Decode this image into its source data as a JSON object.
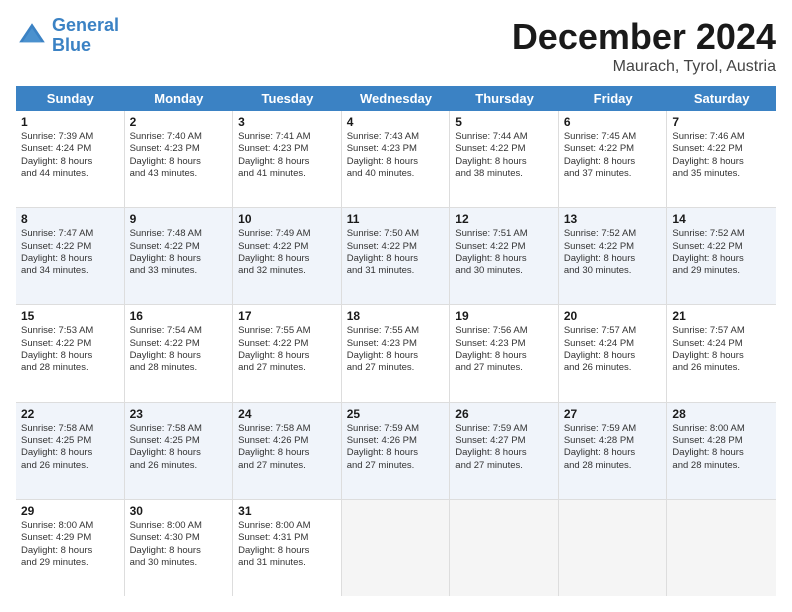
{
  "logo": {
    "line1": "General",
    "line2": "Blue"
  },
  "header": {
    "title": "December 2024",
    "subtitle": "Maurach, Tyrol, Austria"
  },
  "days": [
    "Sunday",
    "Monday",
    "Tuesday",
    "Wednesday",
    "Thursday",
    "Friday",
    "Saturday"
  ],
  "weeks": [
    [
      {
        "day": "1",
        "sunrise": "Sunrise: 7:39 AM",
        "sunset": "Sunset: 4:24 PM",
        "daylight": "Daylight: 8 hours",
        "minutes": "and 44 minutes.",
        "shaded": false
      },
      {
        "day": "2",
        "sunrise": "Sunrise: 7:40 AM",
        "sunset": "Sunset: 4:23 PM",
        "daylight": "Daylight: 8 hours",
        "minutes": "and 43 minutes.",
        "shaded": false
      },
      {
        "day": "3",
        "sunrise": "Sunrise: 7:41 AM",
        "sunset": "Sunset: 4:23 PM",
        "daylight": "Daylight: 8 hours",
        "minutes": "and 41 minutes.",
        "shaded": false
      },
      {
        "day": "4",
        "sunrise": "Sunrise: 7:43 AM",
        "sunset": "Sunset: 4:23 PM",
        "daylight": "Daylight: 8 hours",
        "minutes": "and 40 minutes.",
        "shaded": false
      },
      {
        "day": "5",
        "sunrise": "Sunrise: 7:44 AM",
        "sunset": "Sunset: 4:22 PM",
        "daylight": "Daylight: 8 hours",
        "minutes": "and 38 minutes.",
        "shaded": false
      },
      {
        "day": "6",
        "sunrise": "Sunrise: 7:45 AM",
        "sunset": "Sunset: 4:22 PM",
        "daylight": "Daylight: 8 hours",
        "minutes": "and 37 minutes.",
        "shaded": false
      },
      {
        "day": "7",
        "sunrise": "Sunrise: 7:46 AM",
        "sunset": "Sunset: 4:22 PM",
        "daylight": "Daylight: 8 hours",
        "minutes": "and 35 minutes.",
        "shaded": false
      }
    ],
    [
      {
        "day": "8",
        "sunrise": "Sunrise: 7:47 AM",
        "sunset": "Sunset: 4:22 PM",
        "daylight": "Daylight: 8 hours",
        "minutes": "and 34 minutes.",
        "shaded": true
      },
      {
        "day": "9",
        "sunrise": "Sunrise: 7:48 AM",
        "sunset": "Sunset: 4:22 PM",
        "daylight": "Daylight: 8 hours",
        "minutes": "and 33 minutes.",
        "shaded": true
      },
      {
        "day": "10",
        "sunrise": "Sunrise: 7:49 AM",
        "sunset": "Sunset: 4:22 PM",
        "daylight": "Daylight: 8 hours",
        "minutes": "and 32 minutes.",
        "shaded": true
      },
      {
        "day": "11",
        "sunrise": "Sunrise: 7:50 AM",
        "sunset": "Sunset: 4:22 PM",
        "daylight": "Daylight: 8 hours",
        "minutes": "and 31 minutes.",
        "shaded": true
      },
      {
        "day": "12",
        "sunrise": "Sunrise: 7:51 AM",
        "sunset": "Sunset: 4:22 PM",
        "daylight": "Daylight: 8 hours",
        "minutes": "and 30 minutes.",
        "shaded": true
      },
      {
        "day": "13",
        "sunrise": "Sunrise: 7:52 AM",
        "sunset": "Sunset: 4:22 PM",
        "daylight": "Daylight: 8 hours",
        "minutes": "and 30 minutes.",
        "shaded": true
      },
      {
        "day": "14",
        "sunrise": "Sunrise: 7:52 AM",
        "sunset": "Sunset: 4:22 PM",
        "daylight": "Daylight: 8 hours",
        "minutes": "and 29 minutes.",
        "shaded": true
      }
    ],
    [
      {
        "day": "15",
        "sunrise": "Sunrise: 7:53 AM",
        "sunset": "Sunset: 4:22 PM",
        "daylight": "Daylight: 8 hours",
        "minutes": "and 28 minutes.",
        "shaded": false
      },
      {
        "day": "16",
        "sunrise": "Sunrise: 7:54 AM",
        "sunset": "Sunset: 4:22 PM",
        "daylight": "Daylight: 8 hours",
        "minutes": "and 28 minutes.",
        "shaded": false
      },
      {
        "day": "17",
        "sunrise": "Sunrise: 7:55 AM",
        "sunset": "Sunset: 4:22 PM",
        "daylight": "Daylight: 8 hours",
        "minutes": "and 27 minutes.",
        "shaded": false
      },
      {
        "day": "18",
        "sunrise": "Sunrise: 7:55 AM",
        "sunset": "Sunset: 4:23 PM",
        "daylight": "Daylight: 8 hours",
        "minutes": "and 27 minutes.",
        "shaded": false
      },
      {
        "day": "19",
        "sunrise": "Sunrise: 7:56 AM",
        "sunset": "Sunset: 4:23 PM",
        "daylight": "Daylight: 8 hours",
        "minutes": "and 27 minutes.",
        "shaded": false
      },
      {
        "day": "20",
        "sunrise": "Sunrise: 7:57 AM",
        "sunset": "Sunset: 4:24 PM",
        "daylight": "Daylight: 8 hours",
        "minutes": "and 26 minutes.",
        "shaded": false
      },
      {
        "day": "21",
        "sunrise": "Sunrise: 7:57 AM",
        "sunset": "Sunset: 4:24 PM",
        "daylight": "Daylight: 8 hours",
        "minutes": "and 26 minutes.",
        "shaded": false
      }
    ],
    [
      {
        "day": "22",
        "sunrise": "Sunrise: 7:58 AM",
        "sunset": "Sunset: 4:25 PM",
        "daylight": "Daylight: 8 hours",
        "minutes": "and 26 minutes.",
        "shaded": true
      },
      {
        "day": "23",
        "sunrise": "Sunrise: 7:58 AM",
        "sunset": "Sunset: 4:25 PM",
        "daylight": "Daylight: 8 hours",
        "minutes": "and 26 minutes.",
        "shaded": true
      },
      {
        "day": "24",
        "sunrise": "Sunrise: 7:58 AM",
        "sunset": "Sunset: 4:26 PM",
        "daylight": "Daylight: 8 hours",
        "minutes": "and 27 minutes.",
        "shaded": true
      },
      {
        "day": "25",
        "sunrise": "Sunrise: 7:59 AM",
        "sunset": "Sunset: 4:26 PM",
        "daylight": "Daylight: 8 hours",
        "minutes": "and 27 minutes.",
        "shaded": true
      },
      {
        "day": "26",
        "sunrise": "Sunrise: 7:59 AM",
        "sunset": "Sunset: 4:27 PM",
        "daylight": "Daylight: 8 hours",
        "minutes": "and 27 minutes.",
        "shaded": true
      },
      {
        "day": "27",
        "sunrise": "Sunrise: 7:59 AM",
        "sunset": "Sunset: 4:28 PM",
        "daylight": "Daylight: 8 hours",
        "minutes": "and 28 minutes.",
        "shaded": true
      },
      {
        "day": "28",
        "sunrise": "Sunrise: 8:00 AM",
        "sunset": "Sunset: 4:28 PM",
        "daylight": "Daylight: 8 hours",
        "minutes": "and 28 minutes.",
        "shaded": true
      }
    ],
    [
      {
        "day": "29",
        "sunrise": "Sunrise: 8:00 AM",
        "sunset": "Sunset: 4:29 PM",
        "daylight": "Daylight: 8 hours",
        "minutes": "and 29 minutes.",
        "shaded": false
      },
      {
        "day": "30",
        "sunrise": "Sunrise: 8:00 AM",
        "sunset": "Sunset: 4:30 PM",
        "daylight": "Daylight: 8 hours",
        "minutes": "and 30 minutes.",
        "shaded": false
      },
      {
        "day": "31",
        "sunrise": "Sunrise: 8:00 AM",
        "sunset": "Sunset: 4:31 PM",
        "daylight": "Daylight: 8 hours",
        "minutes": "and 31 minutes.",
        "shaded": false
      },
      null,
      null,
      null,
      null
    ]
  ]
}
